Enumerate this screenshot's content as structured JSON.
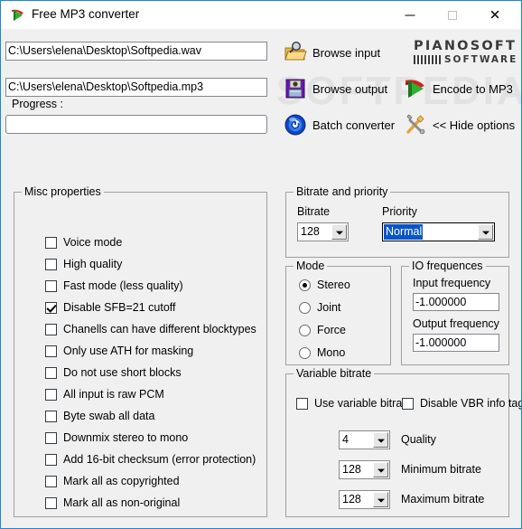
{
  "window": {
    "title": "Free MP3 converter",
    "icon": "mp3-encoder-icon",
    "minimize_label": "—",
    "maximize_label": "",
    "close_label": "✕",
    "accent_border": "#1d86d0"
  },
  "watermark": "SOFTPEDIA",
  "paths": {
    "input_value": "C:\\Users\\elena\\Desktop\\Softpedia.wav",
    "output_value": "C:\\Users\\elena\\Desktop\\Softpedia.mp3",
    "progress_label": "Progress :",
    "progress_value": ""
  },
  "toolbar": {
    "browse_input": "Browse input",
    "browse_output": "Browse output",
    "batch_converter": "Batch converter",
    "encode_to_mp3": "Encode to MP3",
    "hide_options": "<< Hide options"
  },
  "logo": {
    "line1": "PIANOSOFT",
    "line2": "SOFTWARE"
  },
  "misc": {
    "title": "Misc properties",
    "items": [
      {
        "label": "Voice mode",
        "checked": false
      },
      {
        "label": "High quality",
        "checked": false
      },
      {
        "label": "Fast mode (less quality)",
        "checked": false
      },
      {
        "label": "Disable SFB=21 cutoff",
        "checked": true
      },
      {
        "label": "Chanells can have different blocktypes",
        "checked": false
      },
      {
        "label": "Only use ATH for masking",
        "checked": false
      },
      {
        "label": "Do not use short blocks",
        "checked": false
      },
      {
        "label": "All input is raw PCM",
        "checked": false
      },
      {
        "label": "Byte swab all data",
        "checked": false
      },
      {
        "label": "Downmix stereo to mono",
        "checked": false
      },
      {
        "label": "Add 16-bit checksum (error protection)",
        "checked": false
      },
      {
        "label": "Mark all as copyrighted",
        "checked": false
      },
      {
        "label": "Mark all as non-original",
        "checked": false
      }
    ]
  },
  "bitrate_priority": {
    "title": "Bitrate and priority",
    "bitrate_label": "Bitrate",
    "bitrate_value": "128",
    "priority_label": "Priority",
    "priority_value": "Normal",
    "priority_highlight_color": "#0a55c8"
  },
  "mode": {
    "title": "Mode",
    "options": [
      {
        "label": "Stereo",
        "selected": true
      },
      {
        "label": "Joint",
        "selected": false
      },
      {
        "label": "Force",
        "selected": false
      },
      {
        "label": "Mono",
        "selected": false
      }
    ]
  },
  "io_frequences": {
    "title": "IO frequences",
    "input_label": "Input frequency",
    "input_value": "-1.000000",
    "output_label": "Output frequency",
    "output_value": "-1.000000"
  },
  "variable_bitrate": {
    "title": "Variable bitrate",
    "use_vbr_label": "Use variable bitrate",
    "use_vbr_checked": false,
    "disable_tag_label": "Disable VBR info tag",
    "disable_tag_checked": false,
    "quality_label": "Quality",
    "quality_value": "4",
    "min_label": "Minimum bitrate",
    "min_value": "128",
    "max_label": "Maximum bitrate",
    "max_value": "128"
  }
}
